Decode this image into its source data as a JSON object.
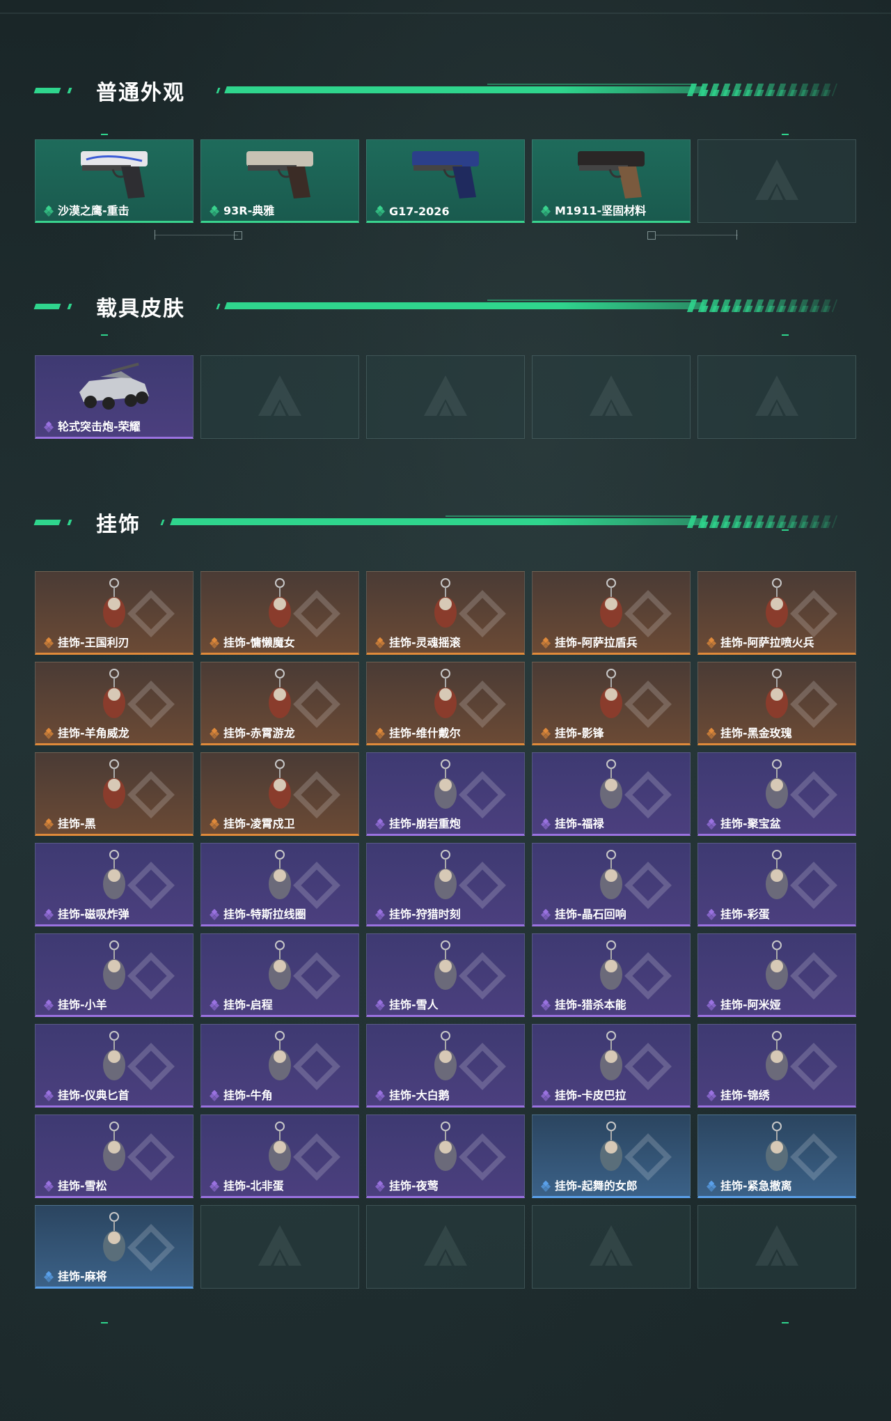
{
  "sections": {
    "weapon": {
      "title": "普通外观",
      "cards": [
        {
          "label": "沙漠之鹰-重击",
          "quality": "green",
          "icon": "pistol-icon"
        },
        {
          "label": "93R-典雅",
          "quality": "green",
          "icon": "pistol-icon"
        },
        {
          "label": "G17-2026",
          "quality": "green",
          "icon": "pistol-icon"
        },
        {
          "label": "M1911-坚固材料",
          "quality": "green",
          "icon": "pistol-icon"
        },
        {
          "label": "",
          "quality": "empty",
          "icon": "empty-slot-icon"
        }
      ]
    },
    "vehicle": {
      "title": "载具皮肤",
      "cards": [
        {
          "label": "轮式突击炮-荣耀",
          "quality": "purple",
          "icon": "vehicle-icon"
        },
        {
          "label": "",
          "quality": "empty",
          "icon": "empty-slot-icon"
        },
        {
          "label": "",
          "quality": "empty",
          "icon": "empty-slot-icon"
        },
        {
          "label": "",
          "quality": "empty",
          "icon": "empty-slot-icon"
        },
        {
          "label": "",
          "quality": "empty",
          "icon": "empty-slot-icon"
        }
      ]
    },
    "charms": {
      "title": "挂饰",
      "cards": [
        {
          "label": "挂饰-王国利刃",
          "quality": "orange"
        },
        {
          "label": "挂饰-慵懒魔女",
          "quality": "orange"
        },
        {
          "label": "挂饰-灵魂摇滚",
          "quality": "orange"
        },
        {
          "label": "挂饰-阿萨拉盾兵",
          "quality": "orange"
        },
        {
          "label": "挂饰-阿萨拉喷火兵",
          "quality": "orange"
        },
        {
          "label": "挂饰-羊角威龙",
          "quality": "orange"
        },
        {
          "label": "挂饰-赤霄游龙",
          "quality": "orange"
        },
        {
          "label": "挂饰-维什戴尔",
          "quality": "orange"
        },
        {
          "label": "挂饰-影锋",
          "quality": "orange"
        },
        {
          "label": "挂饰-黑金玫瑰",
          "quality": "orange"
        },
        {
          "label": "挂饰-黑",
          "quality": "orange"
        },
        {
          "label": "挂饰-凌霄戍卫",
          "quality": "orange"
        },
        {
          "label": "挂饰-崩岩重炮",
          "quality": "purple"
        },
        {
          "label": "挂饰-福禄",
          "quality": "purple"
        },
        {
          "label": "挂饰-聚宝盆",
          "quality": "purple"
        },
        {
          "label": "挂饰-磁吸炸弹",
          "quality": "purple"
        },
        {
          "label": "挂饰-特斯拉线圈",
          "quality": "purple"
        },
        {
          "label": "挂饰-狩猎时刻",
          "quality": "purple"
        },
        {
          "label": "挂饰-晶石回响",
          "quality": "purple"
        },
        {
          "label": "挂饰-彩蛋",
          "quality": "purple"
        },
        {
          "label": "挂饰-小羊",
          "quality": "purple"
        },
        {
          "label": "挂饰-启程",
          "quality": "purple"
        },
        {
          "label": "挂饰-雪人",
          "quality": "purple"
        },
        {
          "label": "挂饰-猎杀本能",
          "quality": "purple"
        },
        {
          "label": "挂饰-阿米娅",
          "quality": "purple"
        },
        {
          "label": "挂饰-仪典匕首",
          "quality": "purple"
        },
        {
          "label": "挂饰-牛角",
          "quality": "purple"
        },
        {
          "label": "挂饰-大白鹅",
          "quality": "purple"
        },
        {
          "label": "挂饰-卡皮巴拉",
          "quality": "purple"
        },
        {
          "label": "挂饰-锦绣",
          "quality": "purple"
        },
        {
          "label": "挂饰-雪松",
          "quality": "purple"
        },
        {
          "label": "挂饰-北非蛋",
          "quality": "purple"
        },
        {
          "label": "挂饰-夜莺",
          "quality": "purple"
        },
        {
          "label": "挂饰-起舞的女郎",
          "quality": "blue"
        },
        {
          "label": "挂饰-紧急撤离",
          "quality": "blue"
        },
        {
          "label": "挂饰-麻将",
          "quality": "blue"
        },
        {
          "label": "",
          "quality": "empty"
        },
        {
          "label": "",
          "quality": "empty"
        },
        {
          "label": "",
          "quality": "empty"
        },
        {
          "label": "",
          "quality": "empty"
        }
      ]
    }
  },
  "colors": {
    "accent": "#2fd58d",
    "green": "#39d38e",
    "purple": "#9a72e0",
    "orange": "#e08a3a",
    "blue": "#5aa0ea"
  }
}
